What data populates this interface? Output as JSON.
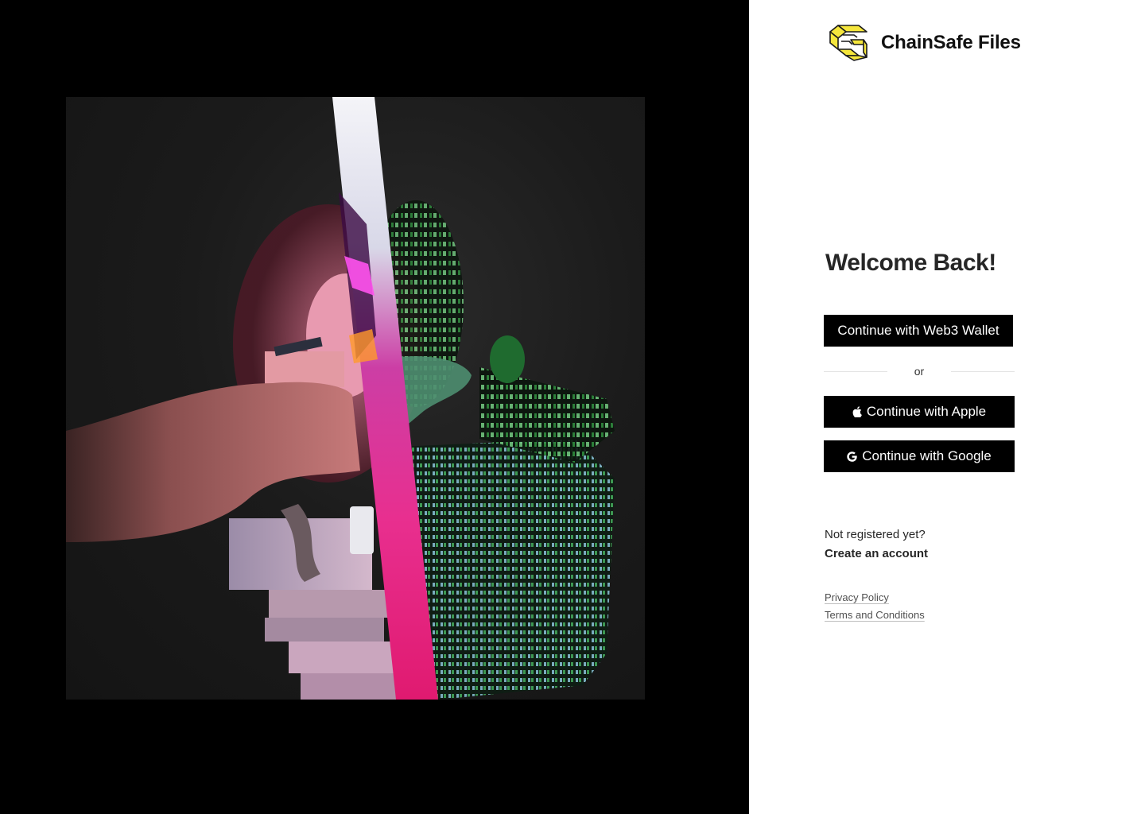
{
  "brand": {
    "name": "ChainSafe Files",
    "logo_icon": "chainsafe-logo-icon",
    "logo_color": "#f5e63c"
  },
  "login": {
    "heading": "Welcome Back!",
    "web3_button": "Continue with Web3 Wallet",
    "divider_text": "or",
    "apple_button": "Continue with Apple",
    "apple_icon": "apple-icon",
    "google_button": "Continue with Google",
    "google_icon": "google-icon"
  },
  "signup": {
    "prompt": "Not registered yet?",
    "link": "Create an account"
  },
  "legal": {
    "privacy": "Privacy Policy",
    "terms": "Terms and Conditions"
  },
  "colors": {
    "left_panel_bg": "#000000",
    "button_bg": "#000000",
    "button_text": "#ffffff",
    "text_dark": "#262626"
  }
}
